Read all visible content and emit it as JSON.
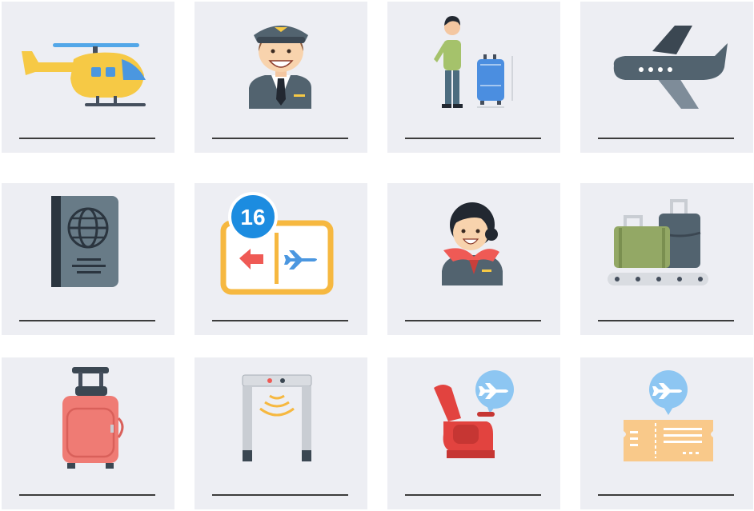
{
  "cards": [
    {
      "icon": "helicopter-icon"
    },
    {
      "icon": "pilot-icon"
    },
    {
      "icon": "traveler-with-luggage-icon"
    },
    {
      "icon": "airplane-icon"
    },
    {
      "icon": "passport-icon"
    },
    {
      "icon": "gate-sign-icon",
      "gate_number": "16"
    },
    {
      "icon": "flight-attendant-icon"
    },
    {
      "icon": "baggage-carousel-icon"
    },
    {
      "icon": "suitcase-icon"
    },
    {
      "icon": "metal-detector-icon"
    },
    {
      "icon": "airplane-seat-icon"
    },
    {
      "icon": "boarding-pass-icon"
    }
  ]
}
